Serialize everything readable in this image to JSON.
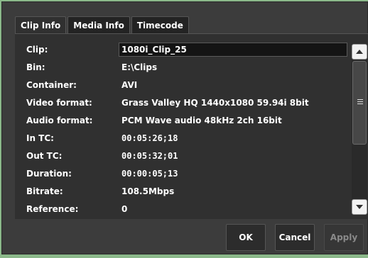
{
  "tabs": [
    {
      "label": "Clip Info"
    },
    {
      "label": "Media Info"
    },
    {
      "label": "Timecode"
    }
  ],
  "rows": [
    {
      "label": "Clip:",
      "value": "1080i_Clip_25"
    },
    {
      "label": "Bin:",
      "value": "E:\\Clips"
    },
    {
      "label": "Container:",
      "value": "AVI"
    },
    {
      "label": "Video format:",
      "value": "Grass Valley HQ 1440x1080 59.94i 8bit"
    },
    {
      "label": "Audio format:",
      "value": "PCM Wave audio 48kHz 2ch 16bit"
    },
    {
      "label": "In TC:",
      "value": "00:05:26;18"
    },
    {
      "label": "Out TC:",
      "value": "00:05:32;01"
    },
    {
      "label": "Duration:",
      "value": "00:00:05;13"
    },
    {
      "label": "Bitrate:",
      "value": "108.5Mbps"
    },
    {
      "label": "Reference:",
      "value": "0"
    }
  ],
  "buttons": {
    "ok": "OK",
    "cancel": "Cancel",
    "apply": "Apply"
  },
  "icons": {
    "scroll_up": "triangle-up-icon",
    "scroll_down": "triangle-down-icon",
    "thumb_grip": "grip-lines-icon"
  },
  "colors": {
    "background": "#8bb88a",
    "dialog": "#3c3c3c",
    "panel": "#303030",
    "text": "#ffffff"
  }
}
